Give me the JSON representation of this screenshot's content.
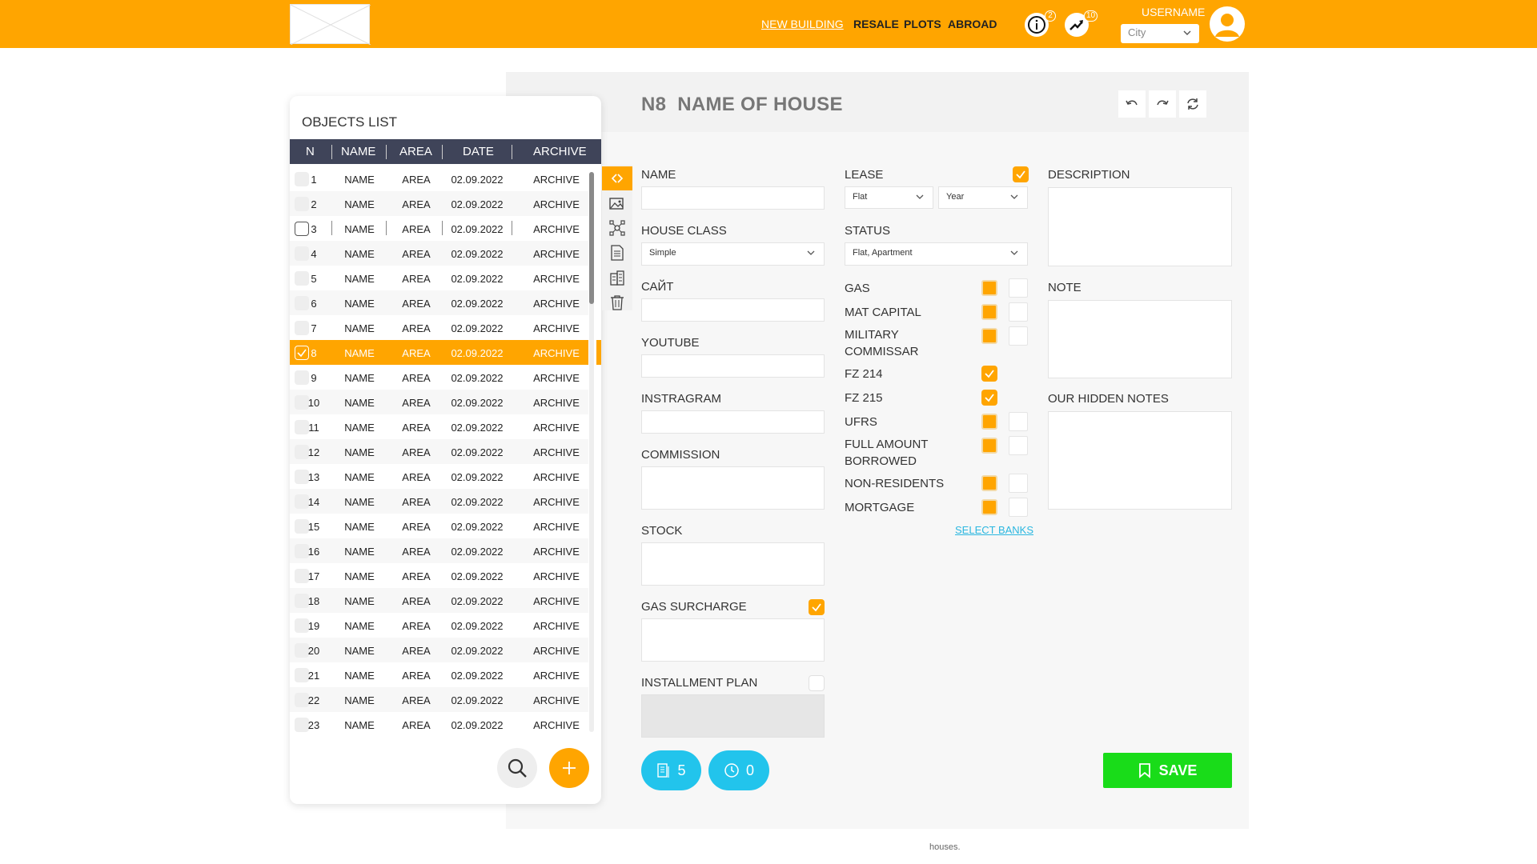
{
  "header": {
    "nav": [
      "NEW BUILDING",
      "RESALE",
      "PLOTS",
      "ABROAD"
    ],
    "info_badge": "2",
    "trend_badge": "10",
    "username": "USERNAME",
    "city_placeholder": "City"
  },
  "page": {
    "title_number": "N8",
    "title_name": "NAME OF HOUSE"
  },
  "objects_list": {
    "title": "OBJECTS LIST",
    "columns": [
      "N",
      "NAME",
      "AREA",
      "DATE",
      "ARCHIVE"
    ],
    "selected_row": 8,
    "rows": [
      {
        "n": "1",
        "name": "NAME",
        "area": "AREA",
        "date": "02.09.2022",
        "archive": "ARCHIVE"
      },
      {
        "n": "2",
        "name": "NAME",
        "area": "AREA",
        "date": "02.09.2022",
        "archive": "ARCHIVE"
      },
      {
        "n": "3",
        "name": "NAME",
        "area": "AREA",
        "date": "02.09.2022",
        "archive": "ARCHIVE"
      },
      {
        "n": "4",
        "name": "NAME",
        "area": "AREA",
        "date": "02.09.2022",
        "archive": "ARCHIVE"
      },
      {
        "n": "5",
        "name": "NAME",
        "area": "AREA",
        "date": "02.09.2022",
        "archive": "ARCHIVE"
      },
      {
        "n": "6",
        "name": "NAME",
        "area": "AREA",
        "date": "02.09.2022",
        "archive": "ARCHIVE"
      },
      {
        "n": "7",
        "name": "NAME",
        "area": "AREA",
        "date": "02.09.2022",
        "archive": "ARCHIVE"
      },
      {
        "n": "8",
        "name": "NAME",
        "area": "AREA",
        "date": "02.09.2022",
        "archive": "ARCHIVE"
      },
      {
        "n": "9",
        "name": "NAME",
        "area": "AREA",
        "date": "02.09.2022",
        "archive": "ARCHIVE"
      },
      {
        "n": "10",
        "name": "NAME",
        "area": "AREA",
        "date": "02.09.2022",
        "archive": "ARCHIVE"
      },
      {
        "n": "11",
        "name": "NAME",
        "area": "AREA",
        "date": "02.09.2022",
        "archive": "ARCHIVE"
      },
      {
        "n": "12",
        "name": "NAME",
        "area": "AREA",
        "date": "02.09.2022",
        "archive": "ARCHIVE"
      },
      {
        "n": "13",
        "name": "NAME",
        "area": "AREA",
        "date": "02.09.2022",
        "archive": "ARCHIVE"
      },
      {
        "n": "14",
        "name": "NAME",
        "area": "AREA",
        "date": "02.09.2022",
        "archive": "ARCHIVE"
      },
      {
        "n": "15",
        "name": "NAME",
        "area": "AREA",
        "date": "02.09.2022",
        "archive": "ARCHIVE"
      },
      {
        "n": "16",
        "name": "NAME",
        "area": "AREA",
        "date": "02.09.2022",
        "archive": "ARCHIVE"
      },
      {
        "n": "17",
        "name": "NAME",
        "area": "AREA",
        "date": "02.09.2022",
        "archive": "ARCHIVE"
      },
      {
        "n": "18",
        "name": "NAME",
        "area": "AREA",
        "date": "02.09.2022",
        "archive": "ARCHIVE"
      },
      {
        "n": "19",
        "name": "NAME",
        "area": "AREA",
        "date": "02.09.2022",
        "archive": "ARCHIVE"
      },
      {
        "n": "20",
        "name": "NAME",
        "area": "AREA",
        "date": "02.09.2022",
        "archive": "ARCHIVE"
      },
      {
        "n": "21",
        "name": "NAME",
        "area": "AREA",
        "date": "02.09.2022",
        "archive": "ARCHIVE"
      },
      {
        "n": "22",
        "name": "NAME",
        "area": "AREA",
        "date": "02.09.2022",
        "archive": "ARCHIVE"
      },
      {
        "n": "23",
        "name": "NAME",
        "area": "AREA",
        "date": "02.09.2022",
        "archive": "ARCHIVE"
      }
    ]
  },
  "form": {
    "name_label": "NAME",
    "house_class_label": "HOUSE CLASS",
    "house_class_value": "Simple",
    "site_label": "САЙТ",
    "youtube_label": "YOUTUBE",
    "instagram_label": "INSTRAGRAM",
    "commission_label": "COMMISSION",
    "stock_label": "STOCK",
    "gas_surcharge_label": "GAS SURCHARGE",
    "installment_label": "INSTALLMENT PLAN",
    "lease_label": "LEASE",
    "lease_type_value": "Flat",
    "lease_period_value": "Year",
    "status_label": "STATUS",
    "status_value": "Flat, Apartment",
    "gas_label": "GAS",
    "mat_capital_label": "MAT CAPITAL",
    "military_line1": "MILITARY",
    "military_line2": "COMMISSAR",
    "fz214_label": "FZ 214",
    "fz215_label": "FZ 215",
    "ufrs_label": "UFRS",
    "full_amount_line1": "FULL AMOUNT",
    "full_amount_line2": "BORROWED",
    "non_residents_label": "NON-RESIDENTS",
    "mortgage_label": "MORTGAGE",
    "select_banks_link": "SELECT BANKS",
    "description_label": "DESCRIPTION",
    "note_label": "NOTE",
    "hidden_notes_label": "OUR HIDDEN NOTES"
  },
  "actions": {
    "docs_count": "5",
    "history_count": "0",
    "save_label": "SAVE"
  },
  "footer": {
    "text": "houses."
  },
  "colors": {
    "accent": "#FFA500",
    "header_table": "#3f4459",
    "pill": "#22c4ec",
    "save": "#19dc19",
    "link": "#2bb7e0"
  }
}
